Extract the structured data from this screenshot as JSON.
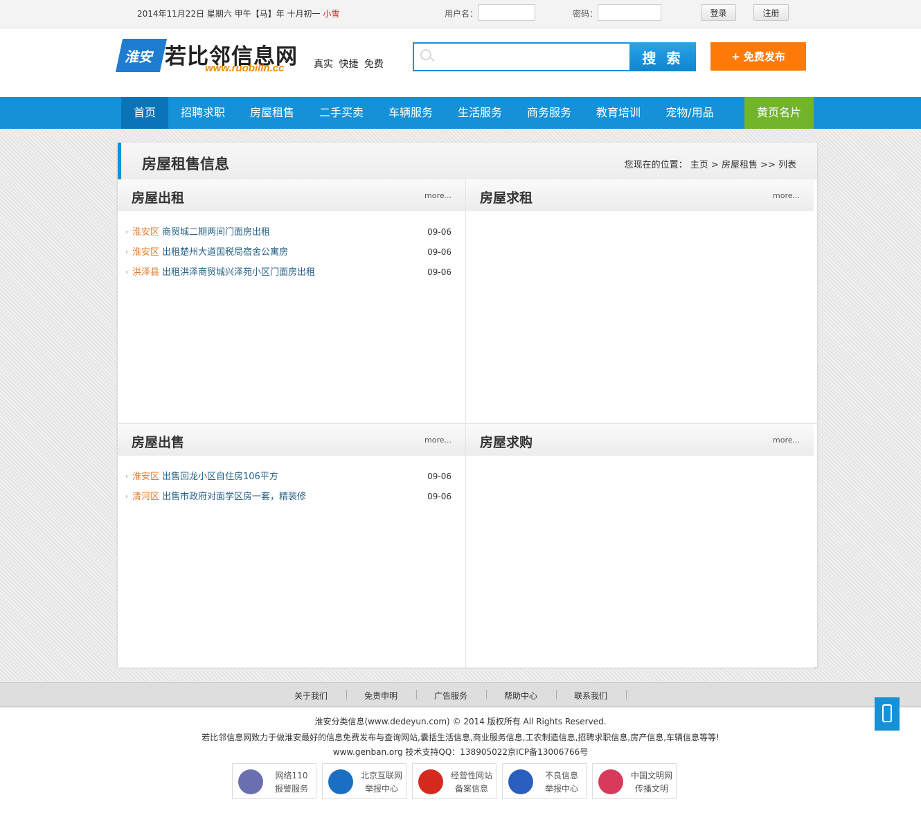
{
  "topbar": {
    "date": "2014年11月22日  星期六   甲午【马】年 十月初一 ",
    "weather": "小雪",
    "username_label": "用户名：",
    "password_label": "密码：",
    "login_label": "登录",
    "register_label": "注册"
  },
  "header": {
    "badge_text": "淮安",
    "site_name": "若比邻信息网",
    "site_url": "www.ruobilin.cc",
    "slogan": "真实 快捷 免费",
    "search_button": "搜 索",
    "publish_button": "+ 免费发布"
  },
  "nav": {
    "items": [
      "首页",
      "招聘求职",
      "房屋租售",
      "二手买卖",
      "车辆服务",
      "生活服务",
      "商务服务",
      "教育培训",
      "宠物/用品",
      "黄页名片"
    ]
  },
  "panel": {
    "title": "房屋租售信息",
    "breadcrumb": "您现在的位置： 主页 > 房屋租售 >> 列表"
  },
  "sections": [
    {
      "title": "房屋出租",
      "more": "more...",
      "items": [
        {
          "area": "淮安区",
          "title": "商贸城二期两间门面房出租",
          "date": "09-06"
        },
        {
          "area": "淮安区",
          "title": "出租楚州大道国税局宿舍公寓房",
          "date": "09-06"
        },
        {
          "area": "洪泽县",
          "title": "出租洪泽商贸城兴泽苑小区门面房出租",
          "date": "09-06"
        }
      ]
    },
    {
      "title": "房屋求租",
      "more": "more...",
      "items": []
    },
    {
      "title": "房屋出售",
      "more": "more...",
      "items": [
        {
          "area": "淮安区",
          "title": "出售回龙小区自住房106平方",
          "date": "09-06"
        },
        {
          "area": "清河区",
          "title": "出售市政府对面学区房一套，精装修",
          "date": "09-06"
        }
      ]
    },
    {
      "title": "房屋求购",
      "more": "more...",
      "items": []
    }
  ],
  "footer": {
    "links": [
      "关于我们",
      "免责申明",
      "广告服务",
      "帮助中心",
      "联系我们"
    ],
    "copyright": "淮安分类信息(www.dedeyun.com) © 2014 版权所有 All Rights Reserved.",
    "description": "若比邻信息网致力于做淮安最好的信息免费发布与查询网站,囊括生活信息,商业服务信息,工农制造信息,招聘求职信息,房产信息,车辆信息等等!",
    "support": "www.genban.org 技术支持QQ：138905022京ICP备13006766号",
    "badges": [
      {
        "line1": "网络110",
        "line2": "报警服务",
        "color": "#6a6fb0"
      },
      {
        "line1": "北京互联网",
        "line2": "举报中心",
        "color": "#1a6fc4"
      },
      {
        "line1": "经营性网站",
        "line2": "备案信息",
        "color": "#d42a1e"
      },
      {
        "line1": "不良信息",
        "line2": "举报中心",
        "color": "#2a5fbf"
      },
      {
        "line1": "中国文明网",
        "line2": "传播文明",
        "color": "#d83a5a"
      }
    ]
  }
}
